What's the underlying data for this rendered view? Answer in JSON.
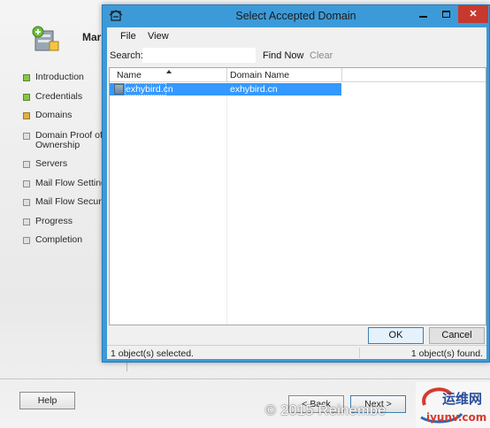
{
  "wizard": {
    "title": "Mar",
    "steps": [
      {
        "label": "Introduction",
        "state": "done"
      },
      {
        "label": "Credentials",
        "state": "done"
      },
      {
        "label": "Domains",
        "state": "current"
      },
      {
        "label": "Domain Proof of Ownership",
        "state": "pending"
      },
      {
        "label": "Servers",
        "state": "pending"
      },
      {
        "label": "Mail Flow Settings",
        "state": "pending"
      },
      {
        "label": "Mail Flow Securit",
        "state": "pending"
      },
      {
        "label": "Progress",
        "state": "pending"
      },
      {
        "label": "Completion",
        "state": "pending"
      }
    ],
    "help_label": "Help",
    "back_label": "< Back",
    "next_label": "Next >",
    "watermark": "© 2015 Reinembe"
  },
  "logo": {
    "text_top": "运维网",
    "text_bottom": "iyunv.com"
  },
  "dialog": {
    "title": "Select Accepted Domain",
    "menu": {
      "file": "File",
      "view": "View"
    },
    "search": {
      "label": "Search:",
      "value": "",
      "find_now": "Find Now",
      "clear": "Clear"
    },
    "columns": {
      "name": "Name",
      "domain": "Domain Name"
    },
    "rows": [
      {
        "name": "exhybird.cn",
        "domain": "exhybird.cn",
        "selected": true
      }
    ],
    "ok_label": "OK",
    "cancel_label": "Cancel",
    "status_left": "1 object(s) selected.",
    "status_right": "1 object(s) found."
  },
  "colors": {
    "accent": "#3d9ad8",
    "selection": "#3399ff",
    "close_button": "#c7392e",
    "step_done": "#8bc34a",
    "step_current": "#e0b03e"
  }
}
